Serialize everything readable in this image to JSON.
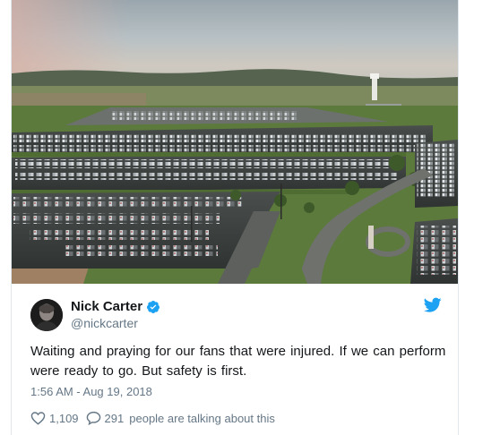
{
  "tweet": {
    "display_name": "Nick Carter",
    "handle": "@nickcarter",
    "text": "Waiting and praying for our fans that were injured. If we can perform were ready to go. But safety is first.",
    "timestamp": "1:56 AM - Aug 19, 2018",
    "like_count": "1,109",
    "reply_count": "291",
    "talking_label": "people are talking about this"
  },
  "icons": {
    "verified": "verified-badge-icon",
    "brand": "twitter-bird-icon",
    "like": "heart-icon",
    "reply": "speech-bubble-icon"
  },
  "colors": {
    "twitter_blue": "#1da1f2",
    "name_text": "#14171a",
    "secondary_text": "#657786"
  }
}
